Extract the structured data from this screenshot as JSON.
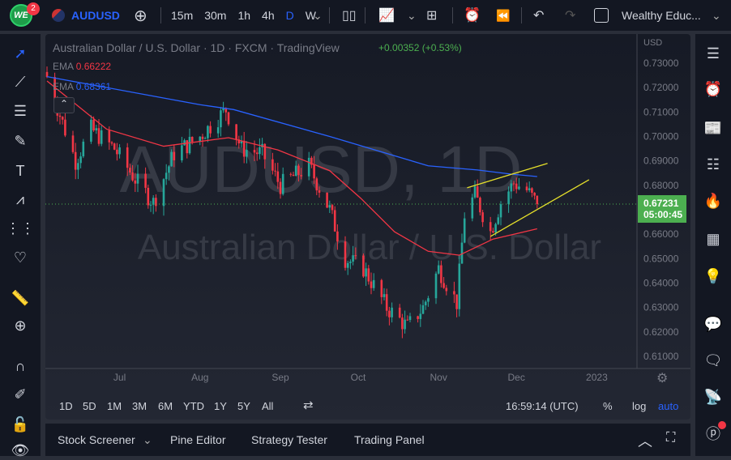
{
  "topbar": {
    "badge": "2",
    "logo": "WE",
    "symbol": "AUDUSD",
    "intervals": [
      "15m",
      "30m",
      "1h",
      "4h",
      "D",
      "W"
    ],
    "active_interval": "D",
    "layout_name": "Wealthy Educ..."
  },
  "legend": {
    "title": "Australian Dollar / U.S. Dollar · 1D · FXCM · TradingView",
    "change": "+0.00352 (+0.53%)",
    "ema1_label": "EMA",
    "ema1_value": "0.66222",
    "ema2_label": "EMA",
    "ema2_value": "0.68361"
  },
  "watermark": {
    "line1": "AUDUSD, 1D",
    "line2": "Australian Dollar / U.S. Dollar"
  },
  "price_axis": {
    "currency": "USD",
    "last_price": "0.67231",
    "countdown": "05:00:45"
  },
  "ranges": [
    "1D",
    "5D",
    "1M",
    "3M",
    "6M",
    "YTD",
    "1Y",
    "5Y",
    "All"
  ],
  "clock": "16:59:14 (UTC)",
  "scale_opts": [
    "%",
    "log",
    "auto"
  ],
  "bottom_tabs": [
    "Stock Screener",
    "Pine Editor",
    "Strategy Tester",
    "Trading Panel"
  ],
  "colors": {
    "up": "#26a69a",
    "down": "#f23645",
    "ema_fast": "#f23645",
    "ema_slow": "#2962ff",
    "trendline": "#e6e02a",
    "accent": "#2962ff",
    "last_price": "#4caf50"
  },
  "chart_data": {
    "type": "candlestick",
    "ylim": [
      0.605,
      0.735
    ],
    "yticks": [
      0.73,
      0.72,
      0.71,
      0.7,
      0.69,
      0.68,
      0.66,
      0.65,
      0.64,
      0.63,
      0.62,
      0.61
    ],
    "xticks": [
      {
        "date": "2022-07-01",
        "label": "Jul"
      },
      {
        "date": "2022-08-01",
        "label": "Aug"
      },
      {
        "date": "2022-09-01",
        "label": "Sep"
      },
      {
        "date": "2022-10-01",
        "label": "Oct"
      },
      {
        "date": "2022-11-01",
        "label": "Nov"
      },
      {
        "date": "2022-12-01",
        "label": "Dec"
      },
      {
        "date": "2023-01-01",
        "label": "2023"
      }
    ],
    "close_path": [
      [
        "2022-06-03",
        0.7244
      ],
      [
        "2022-06-14",
        0.69
      ],
      [
        "2022-06-20",
        0.703
      ],
      [
        "2022-06-29",
        0.695
      ],
      [
        "2022-07-08",
        0.681
      ],
      [
        "2022-07-14",
        0.673
      ],
      [
        "2022-07-22",
        0.693
      ],
      [
        "2022-08-01",
        0.7
      ],
      [
        "2022-08-11",
        0.711
      ],
      [
        "2022-08-17",
        0.695
      ],
      [
        "2022-08-25",
        0.693
      ],
      [
        "2022-09-01",
        0.68
      ],
      [
        "2022-09-12",
        0.688
      ],
      [
        "2022-09-20",
        0.67
      ],
      [
        "2022-09-26",
        0.65
      ],
      [
        "2022-10-03",
        0.646
      ],
      [
        "2022-10-12",
        0.63
      ],
      [
        "2022-10-20",
        0.622
      ],
      [
        "2022-10-26",
        0.63
      ],
      [
        "2022-11-01",
        0.646
      ],
      [
        "2022-11-08",
        0.632
      ],
      [
        "2022-11-11",
        0.668
      ],
      [
        "2022-11-15",
        0.676
      ],
      [
        "2022-11-21",
        0.661
      ],
      [
        "2022-11-25",
        0.673
      ],
      [
        "2022-11-30",
        0.681
      ],
      [
        "2022-12-05",
        0.678
      ],
      [
        "2022-12-09",
        0.6723
      ]
    ],
    "ema_fast": [
      [
        "2022-06-03",
        0.7227
      ],
      [
        "2022-06-26",
        0.703
      ],
      [
        "2022-07-18",
        0.696
      ],
      [
        "2022-08-12",
        0.6995
      ],
      [
        "2022-08-31",
        0.6945
      ],
      [
        "2022-09-20",
        0.686
      ],
      [
        "2022-10-02",
        0.6747
      ],
      [
        "2022-10-15",
        0.661
      ],
      [
        "2022-10-28",
        0.653
      ],
      [
        "2022-11-09",
        0.6514
      ],
      [
        "2022-11-22",
        0.658
      ],
      [
        "2022-12-09",
        0.6622
      ]
    ],
    "ema_slow": [
      [
        "2022-06-03",
        0.7245
      ],
      [
        "2022-08-01",
        0.713
      ],
      [
        "2022-08-14",
        0.711
      ],
      [
        "2022-09-20",
        0.7
      ],
      [
        "2022-10-28",
        0.688
      ],
      [
        "2022-11-16",
        0.6863
      ],
      [
        "2022-11-29",
        0.6846
      ],
      [
        "2022-12-09",
        0.6836
      ]
    ],
    "trendlines": [
      [
        [
          "2022-11-12",
          0.679
        ],
        [
          "2022-12-13",
          0.689
        ]
      ],
      [
        [
          "2022-11-21",
          0.6591
        ],
        [
          "2022-12-29",
          0.6823
        ]
      ]
    ],
    "last_price": 0.67231
  }
}
